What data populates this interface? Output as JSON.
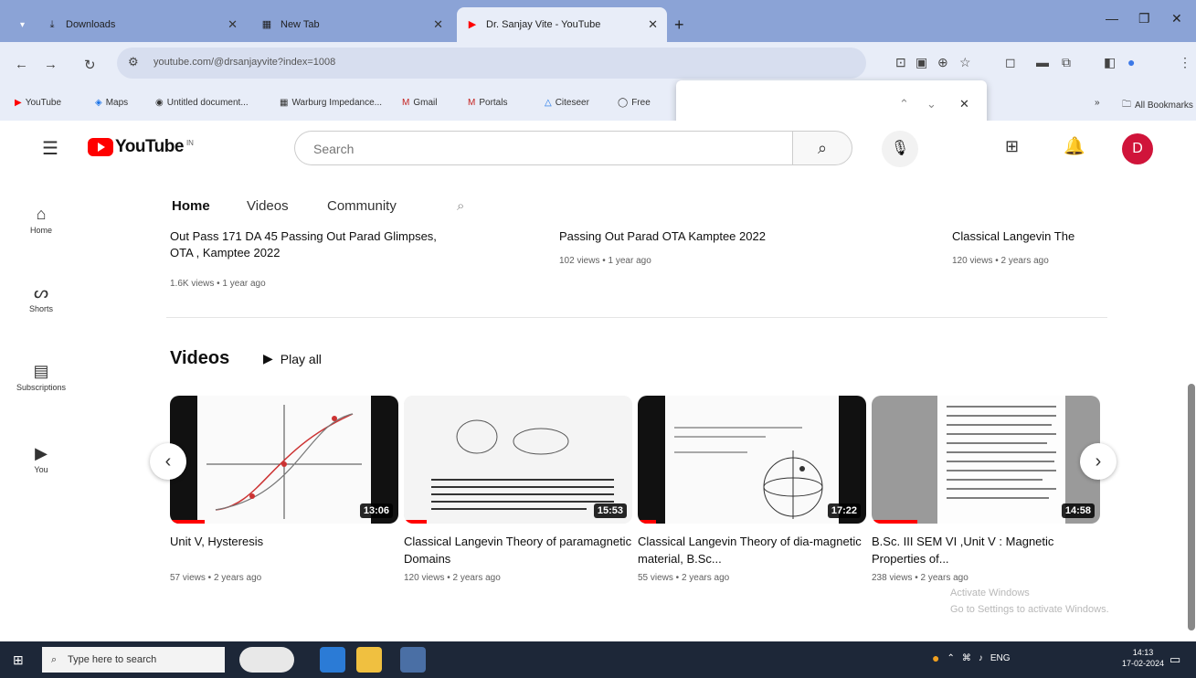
{
  "browser": {
    "tabs": [
      {
        "label": "Downloads",
        "icon": "download-icon"
      },
      {
        "label": "New Tab",
        "icon": "newtab-icon"
      },
      {
        "label": "Dr. Sanjay Vite - YouTube",
        "icon": "youtube-icon",
        "active": true
      }
    ],
    "new_tab": "+",
    "url": "youtube.com/@drsanjayvite?index=1008",
    "bookmarks": [
      "YouTube",
      "Maps",
      "Untitled document...",
      "Warburg Impedance...",
      "Gmail",
      "Portals",
      "Citeseer",
      "Free"
    ],
    "bookmarks_more": "»",
    "all_bookmarks": "All Bookmarks"
  },
  "find_bar": {
    "prev": "⌃",
    "next": "⌄",
    "close": "✕"
  },
  "youtube": {
    "logo_text": "YouTube",
    "logo_sup": "IN",
    "search_placeholder": "Search",
    "avatar_letter": "D",
    "guide": [
      {
        "label": "Home",
        "icon": "home-icon"
      },
      {
        "label": "Shorts",
        "icon": "shorts-icon"
      },
      {
        "label": "Subscriptions",
        "icon": "subscriptions-icon"
      },
      {
        "label": "You",
        "icon": "you-icon"
      }
    ],
    "channel_tabs": [
      "Home",
      "Videos",
      "Community"
    ],
    "upper_shelf": [
      {
        "title_line1": "Out Pass 171 DA 45 Passing Out Parad Glimpses,",
        "title_line2": "OTA , Kamptee 2022",
        "meta": "1.6K views • 1 year ago"
      },
      {
        "title_line1": "Passing Out Parad OTA Kamptee 2022",
        "title_line2": "",
        "meta": "102 views • 1 year ago"
      },
      {
        "title_line1": "Classical Langevin The",
        "title_line2": "",
        "meta": "120 views • 2 years ago"
      }
    ],
    "videos_shelf": {
      "title": "Videos",
      "play_all": "Play all",
      "items": [
        {
          "title": "Unit V, Hysteresis",
          "meta": "57 views • 2 years ago",
          "duration": "13:06",
          "progress": 0.15
        },
        {
          "title": "Classical Langevin Theory of paramagnetic Domains",
          "meta": "120 views • 2 years ago",
          "duration": "15:53",
          "progress": 0.1
        },
        {
          "title": "Classical Langevin Theory of dia-magnetic material, B.Sc...",
          "meta": "55 views • 2 years ago",
          "duration": "17:22",
          "progress": 0.08
        },
        {
          "title": "B.Sc. III SEM VI ,Unit V : Magnetic Properties of...",
          "meta": "238 views • 2 years ago",
          "duration": "14:58",
          "progress": 0.2
        }
      ]
    }
  },
  "watermark": {
    "line1": "Activate Windows",
    "line2": "Go to Settings to activate Windows."
  },
  "taskbar": {
    "search_placeholder": "Type here to search",
    "clock_time": "14:13",
    "clock_date": "17-02-2024",
    "tray_lang": "ENG"
  }
}
